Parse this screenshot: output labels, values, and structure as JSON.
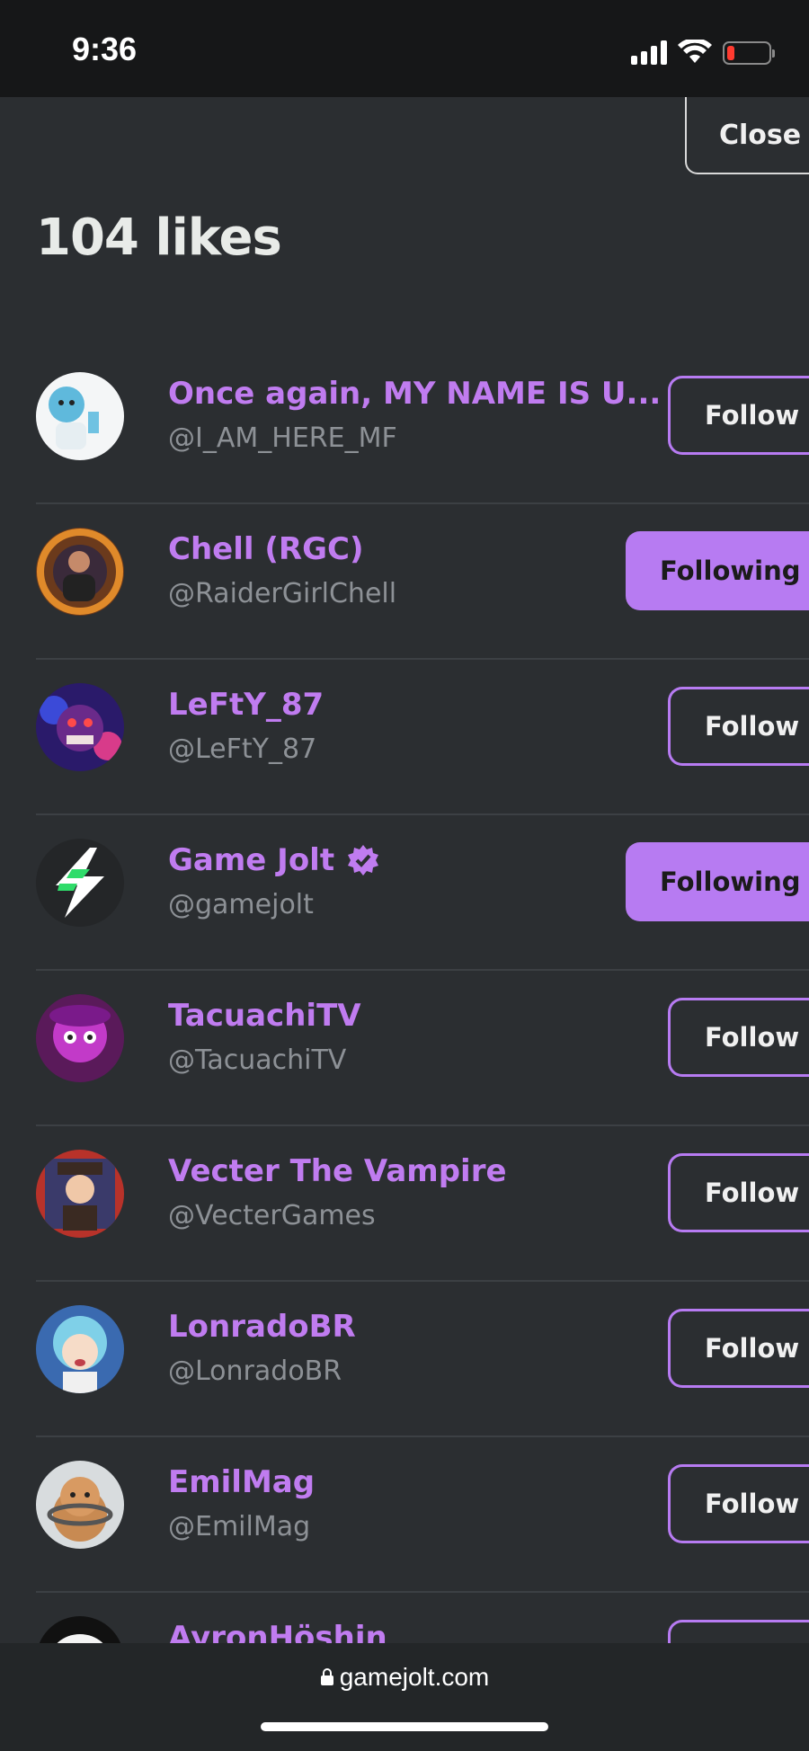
{
  "status_bar": {
    "time": "9:36",
    "battery_level": 0.18
  },
  "modal": {
    "close_label": "Close",
    "title": "104 likes"
  },
  "users": [
    {
      "name": "Once again, MY NAME IS U...",
      "handle": "@I_AM_HERE_MF",
      "button": "Follow",
      "state": "follow",
      "verified": false,
      "avatar": "white-blue character avatar"
    },
    {
      "name": "Chell (RGC)",
      "handle": "@RaiderGirlChell",
      "button": "Following",
      "state": "following",
      "verified": false,
      "avatar": "orange ring character avatar"
    },
    {
      "name": "LeFtY_87",
      "handle": "@LeFtY_87",
      "button": "Follow",
      "state": "follow",
      "verified": false,
      "avatar": "purple animatronic avatar"
    },
    {
      "name": "Game Jolt",
      "handle": "@gamejolt",
      "button": "Following",
      "state": "following",
      "verified": true,
      "avatar": "game jolt bolt logo"
    },
    {
      "name": "TacuachiTV",
      "handle": "@TacuachiTV",
      "button": "Follow",
      "state": "follow",
      "verified": false,
      "avatar": "magenta character avatar"
    },
    {
      "name": "Vecter The Vampire",
      "handle": "@VecterGames",
      "button": "Follow",
      "state": "follow",
      "verified": false,
      "avatar": "red framed vampire avatar"
    },
    {
      "name": "LonradoBR",
      "handle": "@LonradoBR",
      "button": "Follow",
      "state": "follow",
      "verified": false,
      "avatar": "teal hair anime avatar"
    },
    {
      "name": "EmilMag",
      "handle": "@EmilMag",
      "button": "Follow",
      "state": "follow",
      "verified": false,
      "avatar": "hamster astronaut avatar"
    },
    {
      "name": "AyronHöshin",
      "handle": "",
      "button": "",
      "state": "follow",
      "verified": false,
      "avatar": "black white avatar"
    }
  ],
  "browser": {
    "url": "gamejolt.com"
  },
  "colors": {
    "accent": "#b77bf2",
    "name": "#c07cf0",
    "background": "#2b2e31"
  }
}
